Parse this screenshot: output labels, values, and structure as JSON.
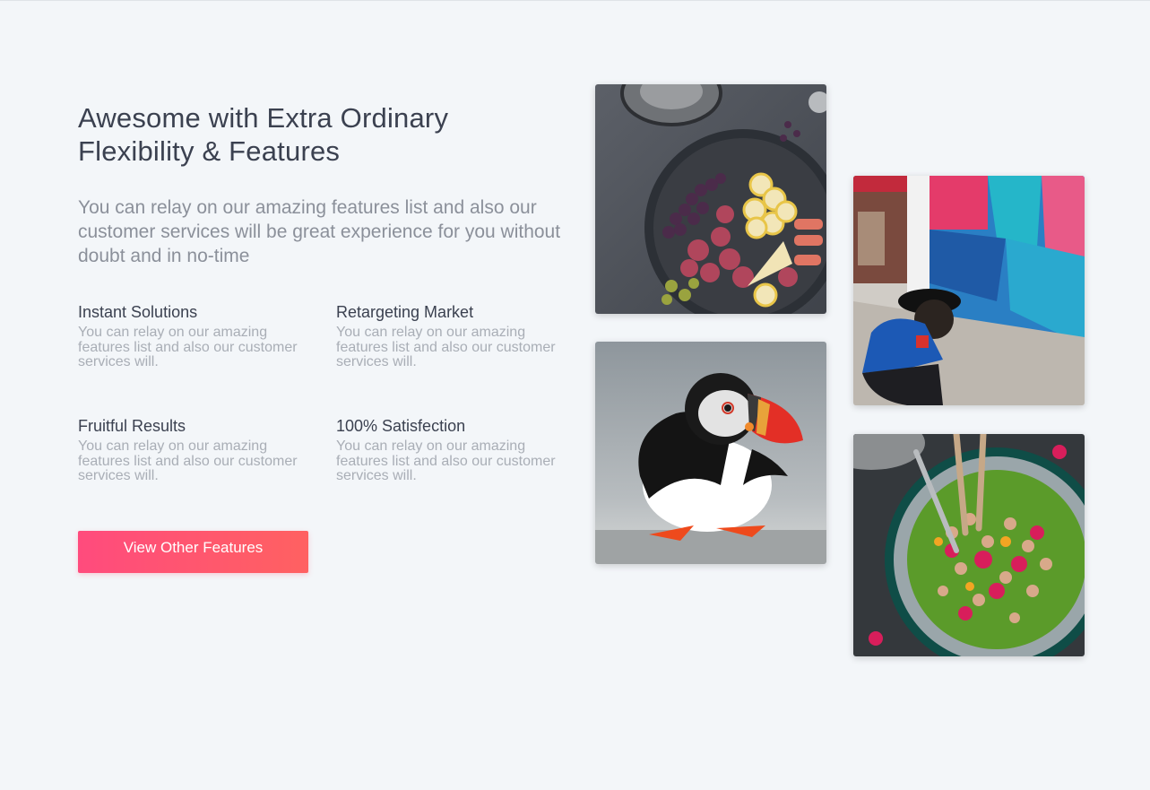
{
  "section": {
    "title": "Awesome with Extra Ordinary Flexibility & Features",
    "description": "You can relay on our amazing features list and also our customer services will be great experience for you without doubt and in no-time"
  },
  "features": [
    {
      "title": "Instant Solutions",
      "description": "You can relay on our amazing features list and also our customer services will."
    },
    {
      "title": "Retargeting Market",
      "description": "You can relay on our amazing features list and also our customer services will."
    },
    {
      "title": "Fruitful Results",
      "description": "You can relay on our amazing features list and also our customer services will."
    },
    {
      "title": "100% Satisfection",
      "description": "You can relay on our amazing features list and also our customer services will."
    }
  ],
  "cta": {
    "label": "View Other Features"
  },
  "gallery": [
    {
      "icon": "food-platter-photo"
    },
    {
      "icon": "puffin-bird-photo"
    },
    {
      "icon": "graffiti-wall-boy-photo"
    },
    {
      "icon": "salad-bowl-photo"
    }
  ],
  "colors": {
    "background": "#f3f6f9",
    "heading": "#3b4150",
    "muted": "#a9aeb6",
    "cta_gradient_start": "#ff4b7d",
    "cta_gradient_end": "#ff6161"
  }
}
